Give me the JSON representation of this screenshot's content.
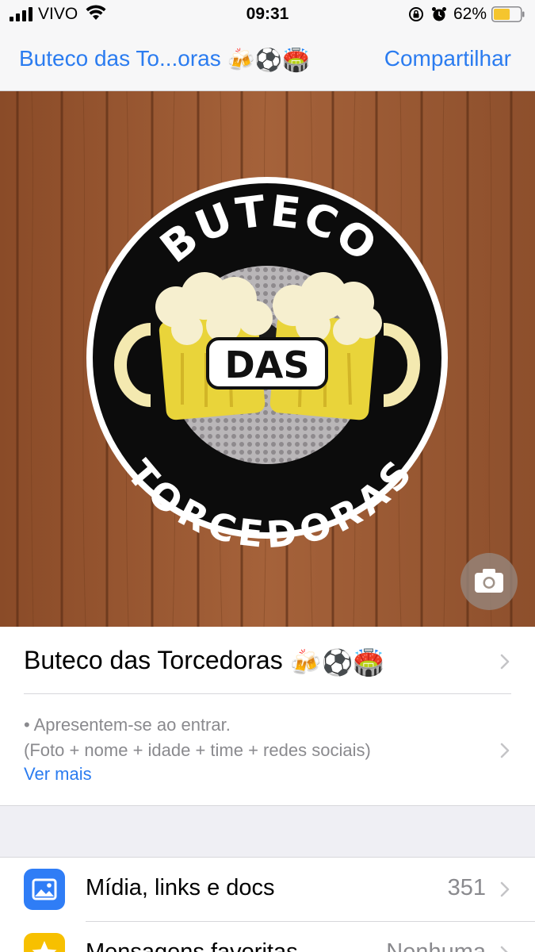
{
  "status_bar": {
    "carrier": "VIVO",
    "time": "09:31",
    "battery": "62%",
    "battery_level": 0.62
  },
  "nav": {
    "title": "Buteco das To...oras",
    "title_emojis": "🍻⚽🏟️",
    "share_label": "Compartilhar"
  },
  "logo": {
    "top_text": "BUTECO",
    "middle_text": "DAS",
    "bottom_text": "TORCEDORAS"
  },
  "group": {
    "name": "Buteco das Torcedoras",
    "name_emojis": "🍻⚽🏟️",
    "description_lines": [
      "• Apresentem-se ao entrar.",
      "(Foto + nome + idade + time + redes sociais)"
    ],
    "see_more": "Ver mais"
  },
  "options": [
    {
      "label": "Mídia, links e docs",
      "value": "351",
      "icon": "photo-icon",
      "color": "#2f7df6"
    },
    {
      "label": "Mensagens favoritas",
      "value": "Nenhuma",
      "icon": "star-icon",
      "color": "#f7c000"
    }
  ],
  "colors": {
    "accent": "#2b7cf0",
    "wood": "#9a5a34"
  }
}
